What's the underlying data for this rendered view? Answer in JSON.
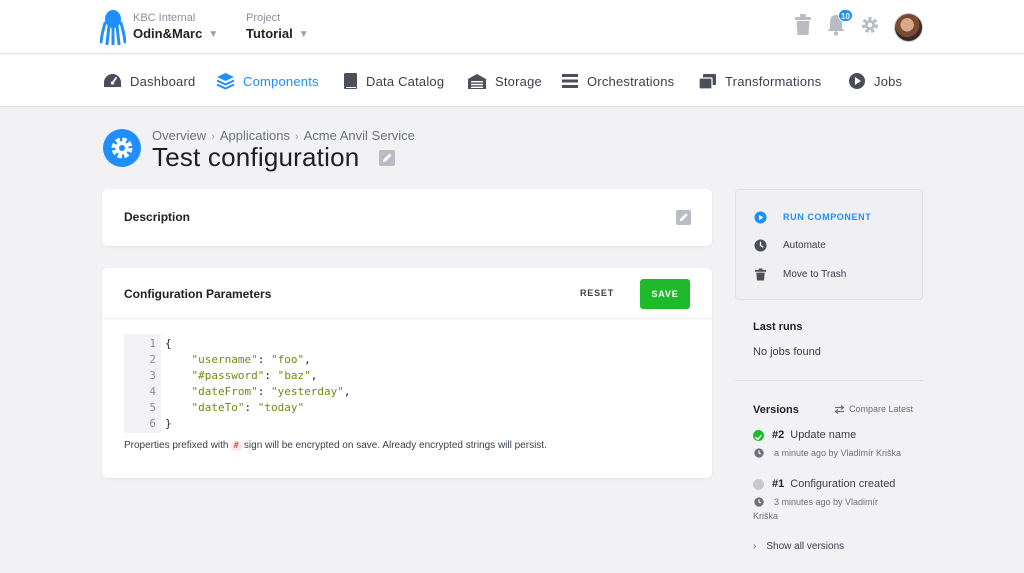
{
  "topbar": {
    "org_label": "KBC Internal",
    "org_name": "Odin&Marc",
    "project_label": "Project",
    "project_name": "Tutorial",
    "notification_count": "10"
  },
  "nav": {
    "items": [
      {
        "label": "Dashboard",
        "icon": "speedometer-icon"
      },
      {
        "label": "Components",
        "icon": "layers-icon",
        "active": true
      },
      {
        "label": "Data Catalog",
        "icon": "book-icon"
      },
      {
        "label": "Storage",
        "icon": "warehouse-icon"
      },
      {
        "label": "Orchestrations",
        "icon": "bars-icon"
      },
      {
        "label": "Transformations",
        "icon": "windows-icon"
      },
      {
        "label": "Jobs",
        "icon": "play-circle-icon"
      }
    ]
  },
  "header": {
    "breadcrumb": [
      "Overview",
      "Applications",
      "Acme Anvil Service"
    ],
    "title": "Test configuration"
  },
  "description": {
    "label": "Description"
  },
  "params": {
    "label": "Configuration Parameters",
    "reset_label": "RESET",
    "save_label": "SAVE",
    "line_numbers": [
      "1",
      "2",
      "3",
      "4",
      "5",
      "6"
    ],
    "open_brace": "{",
    "close_brace": "}",
    "entries": [
      {
        "key": "\"username\"",
        "value": "\"foo\"",
        "trail": ","
      },
      {
        "key": "\"#password\"",
        "value": "\"baz\"",
        "trail": ","
      },
      {
        "key": "\"dateFrom\"",
        "value": "\"yesterday\"",
        "trail": ","
      },
      {
        "key": "\"dateTo\"",
        "value": "\"today\"",
        "trail": ""
      }
    ],
    "hint_before": "Properties prefixed with",
    "hint_chip": "#",
    "hint_after": "sign will be encrypted on save. Already encrypted strings will persist."
  },
  "sidebar": {
    "actions": {
      "run": "RUN COMPONENT",
      "automate": "Automate",
      "trash": "Move to Trash"
    },
    "last_runs": {
      "title": "Last runs",
      "empty": "No jobs found"
    },
    "versions": {
      "title": "Versions",
      "compare_label": "Compare Latest",
      "items": [
        {
          "number": "#2",
          "name": "Update name",
          "meta": "a minute ago by Vladimír Kriška",
          "status_color": "#1fba2c"
        },
        {
          "number": "#1",
          "name": "Configuration created",
          "meta_line1": "3 minutes ago by Vladimír",
          "meta_line2": "Kriška",
          "status_color": "#c8c9cf"
        }
      ],
      "show_all": "Show all versions"
    }
  },
  "colors": {
    "accent": "#1f8fff",
    "success": "#1fba2c",
    "code_string": "#6b8e0d"
  }
}
